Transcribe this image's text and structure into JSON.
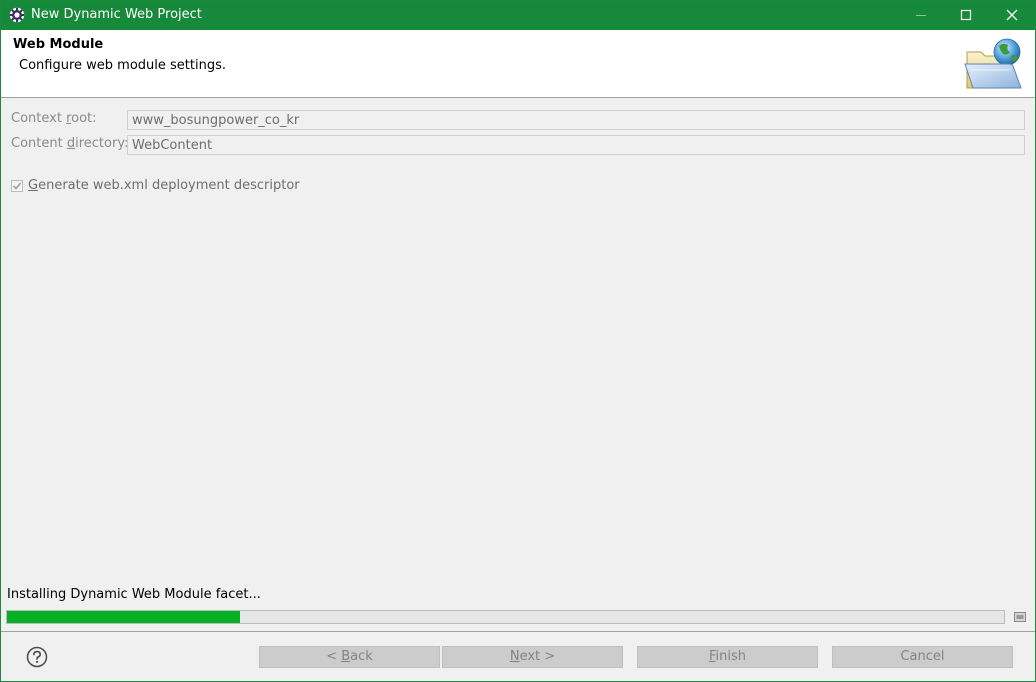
{
  "window": {
    "title": "New Dynamic Web Project",
    "accent_color": "#168a3a",
    "icon": "eclipse-gear-icon"
  },
  "banner": {
    "title": "Web Module",
    "description": "Configure web module settings.",
    "graphic_icon": "open-folder-globe-icon"
  },
  "form": {
    "context_root": {
      "label_pre": "Context ",
      "label_mnemonic": "r",
      "label_post": "oot:",
      "value": "www_bosungpower_co_kr"
    },
    "content_directory": {
      "label_pre": "Content ",
      "label_mnemonic": "d",
      "label_post": "irectory:",
      "value": "WebContent"
    },
    "generate_web_xml": {
      "label_mnemonic": "G",
      "label_post": "enerate web.xml deployment descriptor",
      "checked": true
    }
  },
  "progress": {
    "label": "Installing Dynamic Web Module facet...",
    "fraction": 0.234,
    "color": "#06b025"
  },
  "buttons": {
    "back": {
      "pre": "< ",
      "mnemonic": "B",
      "post": "ack"
    },
    "next": {
      "pre": "",
      "mnemonic": "N",
      "post": "ext >"
    },
    "finish": {
      "pre": "",
      "mnemonic": "F",
      "post": "inish"
    },
    "cancel": {
      "label": "Cancel"
    }
  }
}
